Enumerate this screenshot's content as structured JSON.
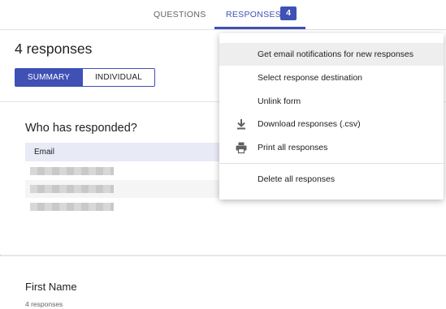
{
  "tabs": {
    "questions": "QUESTIONS",
    "responses": "RESPONSES",
    "response_count_badge": "4"
  },
  "summary_header": {
    "title": "4 responses",
    "summary_label": "SUMMARY",
    "individual_label": "INDIVIDUAL"
  },
  "who_responded": {
    "title": "Who has responded?",
    "column_header": "Email",
    "rows": [
      "",
      "",
      ""
    ]
  },
  "question_card": {
    "title": "First Name",
    "subtitle": "4 responses"
  },
  "menu": {
    "items": [
      {
        "label": "Get email notifications for new responses",
        "icon": ""
      },
      {
        "label": "Select response destination",
        "icon": ""
      },
      {
        "label": "Unlink form",
        "icon": ""
      },
      {
        "label": "Download responses (.csv)",
        "icon": "download-icon"
      },
      {
        "label": "Print all responses",
        "icon": "print-icon"
      },
      {
        "label": "Delete all responses",
        "icon": ""
      }
    ]
  },
  "colors": {
    "accent": "#3f51b5",
    "header_row": "#e8eaf6"
  }
}
